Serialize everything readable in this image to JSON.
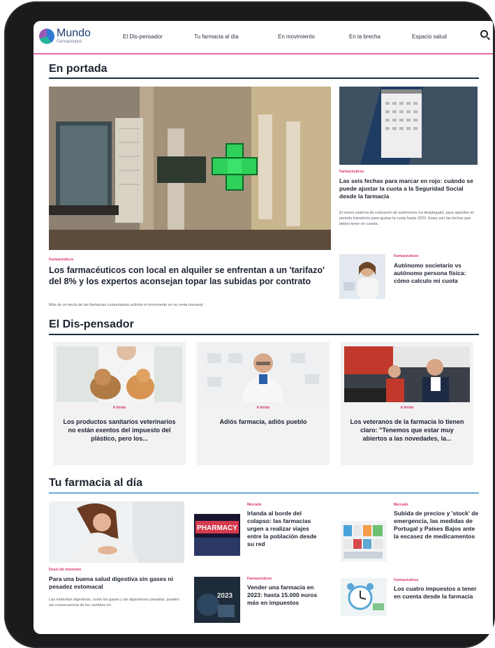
{
  "nav": {
    "logo_name": "Mundo",
    "logo_sub": "Farmacéutico",
    "items": [
      {
        "label": "El Dis-pensador"
      },
      {
        "label": "Tu farmacia al día"
      },
      {
        "label": "En movimiento"
      },
      {
        "label": "En la brecha"
      },
      {
        "label": "Espacio salud"
      }
    ]
  },
  "portada": {
    "title": "En portada",
    "main": {
      "tag": "Farmacéuticos",
      "headline": "Los farmacéuticos con local en alquiler se enfrentan a un 'tarifazo' del 8% y los expertos aconsejan topar las subidas por contrato",
      "summary": "Más de un tercio de las farmacias comunitarias sufrirán el incremento en su renta mensual"
    },
    "side1": {
      "tag": "Farmacéuticos",
      "headline": "Las seis fechas para marcar en rojo: cuándo se puede ajustar la cuota a la Seguridad Social desde la farmacia",
      "summary": "El nuevo sistema de cotización de autónomos ha desplegado, para aquellos en periodo transitorio para ajustar la cuota hasta 2023. Estas son las fechas que debes tener en cuenta."
    },
    "side2": {
      "tag": "Farmacéuticos",
      "headline": "Autónomo societario vs autónomo persona física: cómo calculo mi cuota"
    }
  },
  "dispensador": {
    "title": "El Dis-pensador",
    "cards": [
      {
        "tag": "A fondo",
        "title": "Los productos sanitarios veterinarios no están exentos del impuesto del plástico, pero los..."
      },
      {
        "tag": "A fondo",
        "title": "Adiós farmacia, adiós pueblo"
      },
      {
        "tag": "A fondo",
        "title": "Los veteranos de la farmacia lo tienen claro: \"Tenemos que estar muy abiertos a las novedades, la..."
      }
    ]
  },
  "tufarmacia": {
    "title": "Tu farmacia al día",
    "main": {
      "tag": "Dosis del momento",
      "headline": "Para una buena salud digestiva sin gases ni pesadez estomacal",
      "summary": "Las molestias digestivas, como los gases y las digestiones pesadas, pueden ser consecuencia de los cambios en"
    },
    "items": [
      {
        "tag": "Mercado",
        "headline": "Irlanda al borde del colapso: las farmacias urgen a realizar viajes entre la población desde su red",
        "photo_label": "PHARMACY"
      },
      {
        "tag": "Mercado",
        "headline": "Subida de precios y 'stock' de emergencia, las medidas de Portugal y Países Bajos ante la escasez de medicamentos"
      },
      {
        "tag": "Farmacéuticos",
        "headline": "Vender una farmacia en 2023: hasta 15.000 euros más en impuestos",
        "photo_label": "2023"
      },
      {
        "tag": "Farmacéuticos",
        "headline": "Los cuatro impuestos a tener en cuenta desde la farmacia"
      }
    ]
  },
  "colors": {
    "accent": "#d6336c",
    "nav_line": "#e86aa8",
    "section_line": "#1c2a44",
    "text": "#1c2430"
  }
}
